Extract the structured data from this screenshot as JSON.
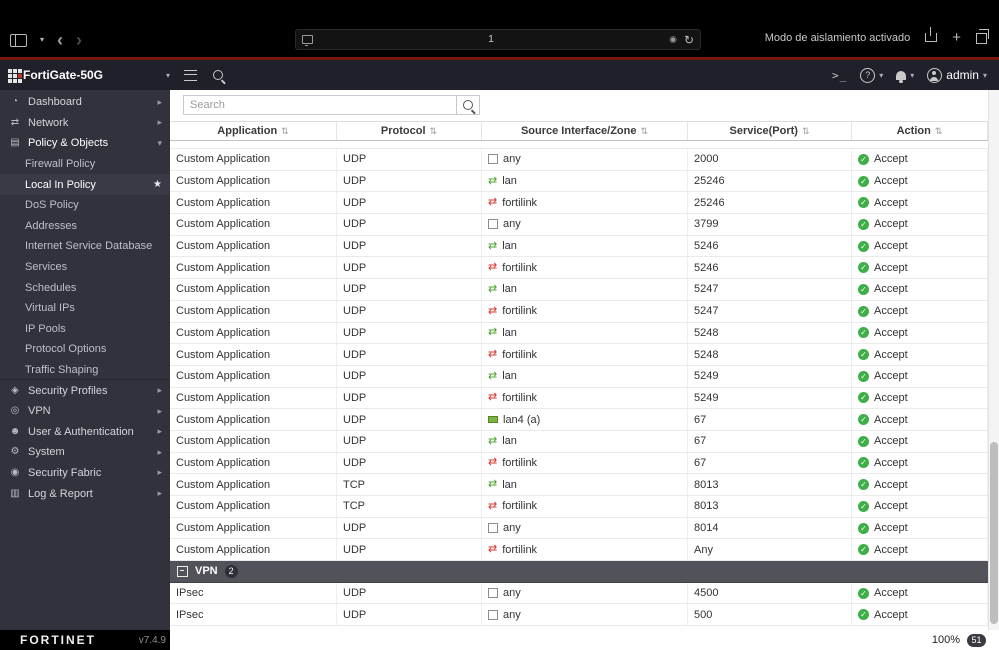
{
  "colors": {
    "accent_red": "#79170d",
    "header_bg": "#20202b",
    "sidebar_bg": "#32323d",
    "accept_green": "#3fae49",
    "lan_icon_green": "#4ca32e",
    "fortilink_icon_red": "#da3327",
    "group_row_bg": "#52525a"
  },
  "browser": {
    "address_text": "1",
    "isolation_text": "Modo de aislamiento activado"
  },
  "header": {
    "device_name": "FortiGate-50G",
    "cli_label": ">_",
    "help_label": "?",
    "admin_label": "admin"
  },
  "sidebar": {
    "items": [
      {
        "label": "Dashboard",
        "type": "section",
        "icon": "gauge",
        "chevron": "right"
      },
      {
        "label": "Network",
        "type": "section",
        "icon": "network",
        "chevron": "right"
      },
      {
        "label": "Policy & Objects",
        "type": "section",
        "icon": "policy",
        "chevron": "down",
        "expanded": true
      },
      {
        "label": "Firewall Policy",
        "type": "sub"
      },
      {
        "label": "Local In Policy",
        "type": "sub",
        "selected": true,
        "star": true
      },
      {
        "label": "DoS Policy",
        "type": "sub"
      },
      {
        "label": "Addresses",
        "type": "sub"
      },
      {
        "label": "Internet Service Database",
        "type": "sub"
      },
      {
        "label": "Services",
        "type": "sub"
      },
      {
        "label": "Schedules",
        "type": "sub"
      },
      {
        "label": "Virtual IPs",
        "type": "sub"
      },
      {
        "label": "IP Pools",
        "type": "sub"
      },
      {
        "label": "Protocol Options",
        "type": "sub"
      },
      {
        "label": "Traffic Shaping",
        "type": "sub",
        "divider_after": true
      },
      {
        "label": "Security Profiles",
        "type": "section",
        "icon": "shield",
        "chevron": "right"
      },
      {
        "label": "VPN",
        "type": "section",
        "icon": "vpn",
        "chevron": "right"
      },
      {
        "label": "User & Authentication",
        "type": "section",
        "icon": "user",
        "chevron": "right"
      },
      {
        "label": "System",
        "type": "section",
        "icon": "gear",
        "chevron": "right"
      },
      {
        "label": "Security Fabric",
        "type": "section",
        "icon": "fabric",
        "chevron": "right"
      },
      {
        "label": "Log & Report",
        "type": "section",
        "icon": "log",
        "chevron": "right"
      }
    ],
    "footer": {
      "brand": "FORTINET",
      "version": "v7.4.9"
    }
  },
  "search": {
    "placeholder": "Search"
  },
  "table": {
    "columns": [
      "Application",
      "Protocol",
      "Source Interface/Zone",
      "Service(Port)",
      "Action"
    ],
    "rows": [
      {
        "kind": "partial"
      },
      {
        "app": "Custom Application",
        "proto": "UDP",
        "iface": "any",
        "iface_icon": "any",
        "port": "2000",
        "action": "Accept"
      },
      {
        "app": "Custom Application",
        "proto": "UDP",
        "iface": "lan",
        "iface_icon": "lan",
        "port": "25246",
        "action": "Accept"
      },
      {
        "app": "Custom Application",
        "proto": "UDP",
        "iface": "fortilink",
        "iface_icon": "fortilink",
        "port": "25246",
        "action": "Accept"
      },
      {
        "app": "Custom Application",
        "proto": "UDP",
        "iface": "any",
        "iface_icon": "any",
        "port": "3799",
        "action": "Accept"
      },
      {
        "app": "Custom Application",
        "proto": "UDP",
        "iface": "lan",
        "iface_icon": "lan",
        "port": "5246",
        "action": "Accept"
      },
      {
        "app": "Custom Application",
        "proto": "UDP",
        "iface": "fortilink",
        "iface_icon": "fortilink",
        "port": "5246",
        "action": "Accept"
      },
      {
        "app": "Custom Application",
        "proto": "UDP",
        "iface": "lan",
        "iface_icon": "lan",
        "port": "5247",
        "action": "Accept"
      },
      {
        "app": "Custom Application",
        "proto": "UDP",
        "iface": "fortilink",
        "iface_icon": "fortilink",
        "port": "5247",
        "action": "Accept"
      },
      {
        "app": "Custom Application",
        "proto": "UDP",
        "iface": "lan",
        "iface_icon": "lan",
        "port": "5248",
        "action": "Accept"
      },
      {
        "app": "Custom Application",
        "proto": "UDP",
        "iface": "fortilink",
        "iface_icon": "fortilink",
        "port": "5248",
        "action": "Accept"
      },
      {
        "app": "Custom Application",
        "proto": "UDP",
        "iface": "lan",
        "iface_icon": "lan",
        "port": "5249",
        "action": "Accept"
      },
      {
        "app": "Custom Application",
        "proto": "UDP",
        "iface": "fortilink",
        "iface_icon": "fortilink",
        "port": "5249",
        "action": "Accept"
      },
      {
        "app": "Custom Application",
        "proto": "UDP",
        "iface": "lan4 (a)",
        "iface_icon": "port",
        "port": "67",
        "action": "Accept"
      },
      {
        "app": "Custom Application",
        "proto": "UDP",
        "iface": "lan",
        "iface_icon": "lan",
        "port": "67",
        "action": "Accept"
      },
      {
        "app": "Custom Application",
        "proto": "UDP",
        "iface": "fortilink",
        "iface_icon": "fortilink",
        "port": "67",
        "action": "Accept"
      },
      {
        "app": "Custom Application",
        "proto": "TCP",
        "iface": "lan",
        "iface_icon": "lan",
        "port": "8013",
        "action": "Accept"
      },
      {
        "app": "Custom Application",
        "proto": "TCP",
        "iface": "fortilink",
        "iface_icon": "fortilink",
        "port": "8013",
        "action": "Accept"
      },
      {
        "app": "Custom Application",
        "proto": "UDP",
        "iface": "any",
        "iface_icon": "any",
        "port": "8014",
        "action": "Accept"
      },
      {
        "app": "Custom Application",
        "proto": "UDP",
        "iface": "fortilink",
        "iface_icon": "fortilink",
        "port": "Any",
        "action": "Accept"
      },
      {
        "kind": "group",
        "label": "VPN",
        "count": "2"
      },
      {
        "app": "IPsec",
        "proto": "UDP",
        "iface": "any",
        "iface_icon": "any",
        "port": "4500",
        "action": "Accept"
      },
      {
        "app": "IPsec",
        "proto": "UDP",
        "iface": "any",
        "iface_icon": "any",
        "port": "500",
        "action": "Accept"
      }
    ]
  },
  "statusbar": {
    "zoom": "100%",
    "badge": "51"
  }
}
